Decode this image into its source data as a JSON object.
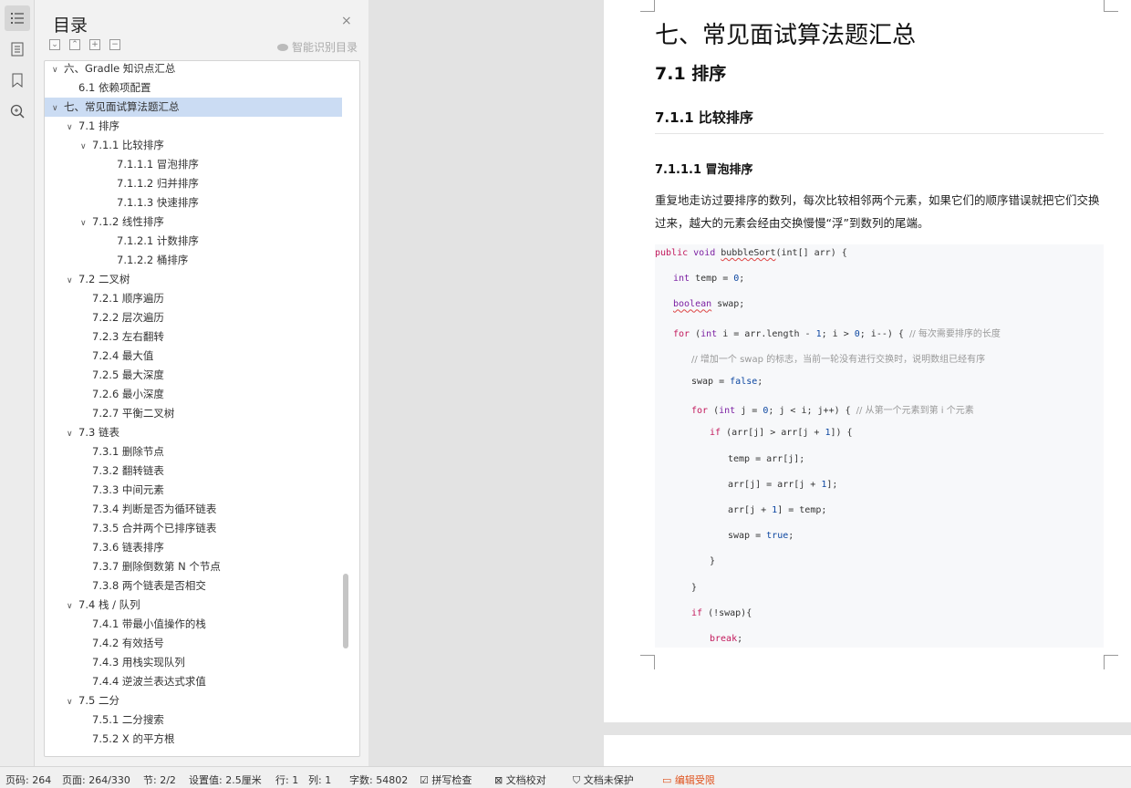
{
  "icons": {
    "toc": "list-icon",
    "doc": "document-icon",
    "bookmark": "bookmark-icon",
    "find": "search-zoom-icon"
  },
  "toc": {
    "title": "目录",
    "close": "×",
    "smart_label": "智能识别目录",
    "items": [
      {
        "text": "六、Gradle 知识点汇总",
        "level": 0,
        "arrow": true,
        "selected": false
      },
      {
        "text": "6.1  依赖项配置",
        "level": 1,
        "arrow": false,
        "selected": false
      },
      {
        "text": "七、常见面试算法题汇总",
        "level": 0,
        "arrow": true,
        "selected": true
      },
      {
        "text": "7.1  排序",
        "level": 1,
        "arrow": true,
        "selected": false
      },
      {
        "text": "7.1.1  比较排序",
        "level": 2,
        "arrow": true,
        "selected": false
      },
      {
        "text": "7.1.1.1  冒泡排序",
        "level": 3,
        "arrow": false,
        "selected": false
      },
      {
        "text": "7.1.1.2  归并排序",
        "level": 3,
        "arrow": false,
        "selected": false
      },
      {
        "text": "7.1.1.3  快速排序",
        "level": 3,
        "arrow": false,
        "selected": false
      },
      {
        "text": "7.1.2  线性排序",
        "level": 2,
        "arrow": true,
        "selected": false
      },
      {
        "text": "7.1.2.1  计数排序",
        "level": 3,
        "arrow": false,
        "selected": false
      },
      {
        "text": "7.1.2.2  桶排序",
        "level": 3,
        "arrow": false,
        "selected": false
      },
      {
        "text": "7.2  二叉树",
        "level": 1,
        "arrow": true,
        "selected": false
      },
      {
        "text": "7.2.1  顺序遍历",
        "level": 2,
        "arrow": false,
        "selected": false
      },
      {
        "text": "7.2.2  层次遍历",
        "level": 2,
        "arrow": false,
        "selected": false
      },
      {
        "text": "7.2.3  左右翻转",
        "level": 2,
        "arrow": false,
        "selected": false
      },
      {
        "text": "7.2.4  最大值",
        "level": 2,
        "arrow": false,
        "selected": false
      },
      {
        "text": "7.2.5  最大深度",
        "level": 2,
        "arrow": false,
        "selected": false
      },
      {
        "text": "7.2.6  最小深度",
        "level": 2,
        "arrow": false,
        "selected": false
      },
      {
        "text": "7.2.7  平衡二叉树",
        "level": 2,
        "arrow": false,
        "selected": false
      },
      {
        "text": "7.3  链表",
        "level": 1,
        "arrow": true,
        "selected": false
      },
      {
        "text": "7.3.1  删除节点",
        "level": 2,
        "arrow": false,
        "selected": false
      },
      {
        "text": "7.3.2  翻转链表",
        "level": 2,
        "arrow": false,
        "selected": false
      },
      {
        "text": "7.3.3  中间元素",
        "level": 2,
        "arrow": false,
        "selected": false
      },
      {
        "text": "7.3.4  判断是否为循环链表",
        "level": 2,
        "arrow": false,
        "selected": false
      },
      {
        "text": "7.3.5  合并两个已排序链表",
        "level": 2,
        "arrow": false,
        "selected": false
      },
      {
        "text": "7.3.6  链表排序",
        "level": 2,
        "arrow": false,
        "selected": false
      },
      {
        "text": "7.3.7  删除倒数第 N 个节点",
        "level": 2,
        "arrow": false,
        "selected": false
      },
      {
        "text": "7.3.8  两个链表是否相交",
        "level": 2,
        "arrow": false,
        "selected": false
      },
      {
        "text": "7.4  栈 / 队列",
        "level": 1,
        "arrow": true,
        "selected": false
      },
      {
        "text": "7.4.1  带最小值操作的栈",
        "level": 2,
        "arrow": false,
        "selected": false
      },
      {
        "text": "7.4.2  有效括号",
        "level": 2,
        "arrow": false,
        "selected": false
      },
      {
        "text": "7.4.3  用栈实现队列",
        "level": 2,
        "arrow": false,
        "selected": false
      },
      {
        "text": "7.4.4  逆波兰表达式求值",
        "level": 2,
        "arrow": false,
        "selected": false
      },
      {
        "text": "7.5  二分",
        "level": 1,
        "arrow": true,
        "selected": false
      },
      {
        "text": "7.5.1  二分搜索",
        "level": 2,
        "arrow": false,
        "selected": false
      },
      {
        "text": "7.5.2 X 的平方根",
        "level": 2,
        "arrow": false,
        "selected": false
      }
    ]
  },
  "doc": {
    "h1": "七、常见面试算法题汇总",
    "h2": "7.1  排序",
    "h3": "7.1.1  比较排序",
    "h4": "7.1.1.1 冒泡排序",
    "para": "重复地走访过要排序的数列，每次比较相邻两个元素，如果它们的顺序错误就把它们交换过来，越大的元素会经由交换慢慢“浮”到数列的尾端。",
    "code": [
      {
        "indent": 0,
        "tokens": [
          [
            "kw",
            "public "
          ],
          [
            "ty",
            "void "
          ],
          [
            "sq",
            "bubbleSort"
          ],
          [
            "",
            "(int[] arr) {"
          ]
        ]
      },
      {
        "indent": 1,
        "tokens": [
          [
            "ty",
            "int "
          ],
          [
            "",
            "temp = "
          ],
          [
            "tk",
            "0"
          ],
          [
            "",
            ";"
          ]
        ]
      },
      {
        "indent": 1,
        "tokens": [
          [
            "sq ty",
            "boolean"
          ],
          [
            "",
            " swap;"
          ]
        ]
      },
      {
        "indent": 1,
        "tokens": [
          [
            "kw",
            "for "
          ],
          [
            "",
            "("
          ],
          [
            "ty",
            "int "
          ],
          [
            "",
            "i = arr.length - "
          ],
          [
            "tk",
            "1"
          ],
          [
            "",
            "; i > "
          ],
          [
            "tk",
            "0"
          ],
          [
            "",
            "; i--) { "
          ],
          [
            "cm",
            "// 每次需要排序的长度"
          ]
        ]
      },
      {
        "indent": 2,
        "tokens": [
          [
            "cm",
            "// 增加一个 swap 的标志，当前一轮没有进行交换时，说明数组已经有序"
          ]
        ]
      },
      {
        "indent": 2,
        "tokens": [
          [
            "",
            "swap = "
          ],
          [
            "tk",
            "false"
          ],
          [
            "",
            ";"
          ]
        ]
      },
      {
        "indent": 2,
        "tokens": [
          [
            "kw",
            "for "
          ],
          [
            "",
            "("
          ],
          [
            "ty",
            "int "
          ],
          [
            "",
            "j = "
          ],
          [
            "tk",
            "0"
          ],
          [
            "",
            "; j < i; j++) { "
          ],
          [
            "cm",
            "// 从第一个元素到第 i 个元素"
          ]
        ]
      },
      {
        "indent": 3,
        "tokens": [
          [
            "kw",
            "if "
          ],
          [
            "",
            "(arr[j] > arr[j + "
          ],
          [
            "tk",
            "1"
          ],
          [
            "",
            "]) {"
          ]
        ]
      },
      {
        "indent": 4,
        "tokens": [
          [
            "",
            "temp = arr[j];"
          ]
        ]
      },
      {
        "indent": 4,
        "tokens": [
          [
            "",
            "arr[j] = arr[j + "
          ],
          [
            "tk",
            "1"
          ],
          [
            "",
            "];"
          ]
        ]
      },
      {
        "indent": 4,
        "tokens": [
          [
            "",
            "arr[j + "
          ],
          [
            "tk",
            "1"
          ],
          [
            "",
            "] = temp;"
          ]
        ]
      },
      {
        "indent": 4,
        "tokens": [
          [
            "",
            "swap = "
          ],
          [
            "tk",
            "true"
          ],
          [
            "",
            ";"
          ]
        ]
      },
      {
        "indent": 3,
        "tokens": [
          [
            "",
            "}"
          ]
        ]
      },
      {
        "indent": 2,
        "tokens": [
          [
            "",
            "}"
          ]
        ]
      },
      {
        "indent": 2,
        "tokens": [
          [
            "kw",
            "if "
          ],
          [
            "",
            "(!swap){"
          ]
        ]
      },
      {
        "indent": 3,
        "tokens": [
          [
            "kw",
            "break"
          ],
          [
            "",
            ";"
          ]
        ]
      }
    ]
  },
  "status": {
    "page_code": "页码: 264",
    "page": "页面: 264/330",
    "section": "节: 2/2",
    "setting": "设置值: 2.5厘米",
    "row": "行: 1",
    "col": "列: 1",
    "words": "字数: 54802",
    "spell": "拼写检查",
    "proof": "文档校对",
    "protect": "文档未保护",
    "edit_limit": "编辑受限"
  },
  "colors": {
    "selected": "#cbdcf3",
    "edit_limit": "#e0531e",
    "keyword": "#c2185b"
  }
}
